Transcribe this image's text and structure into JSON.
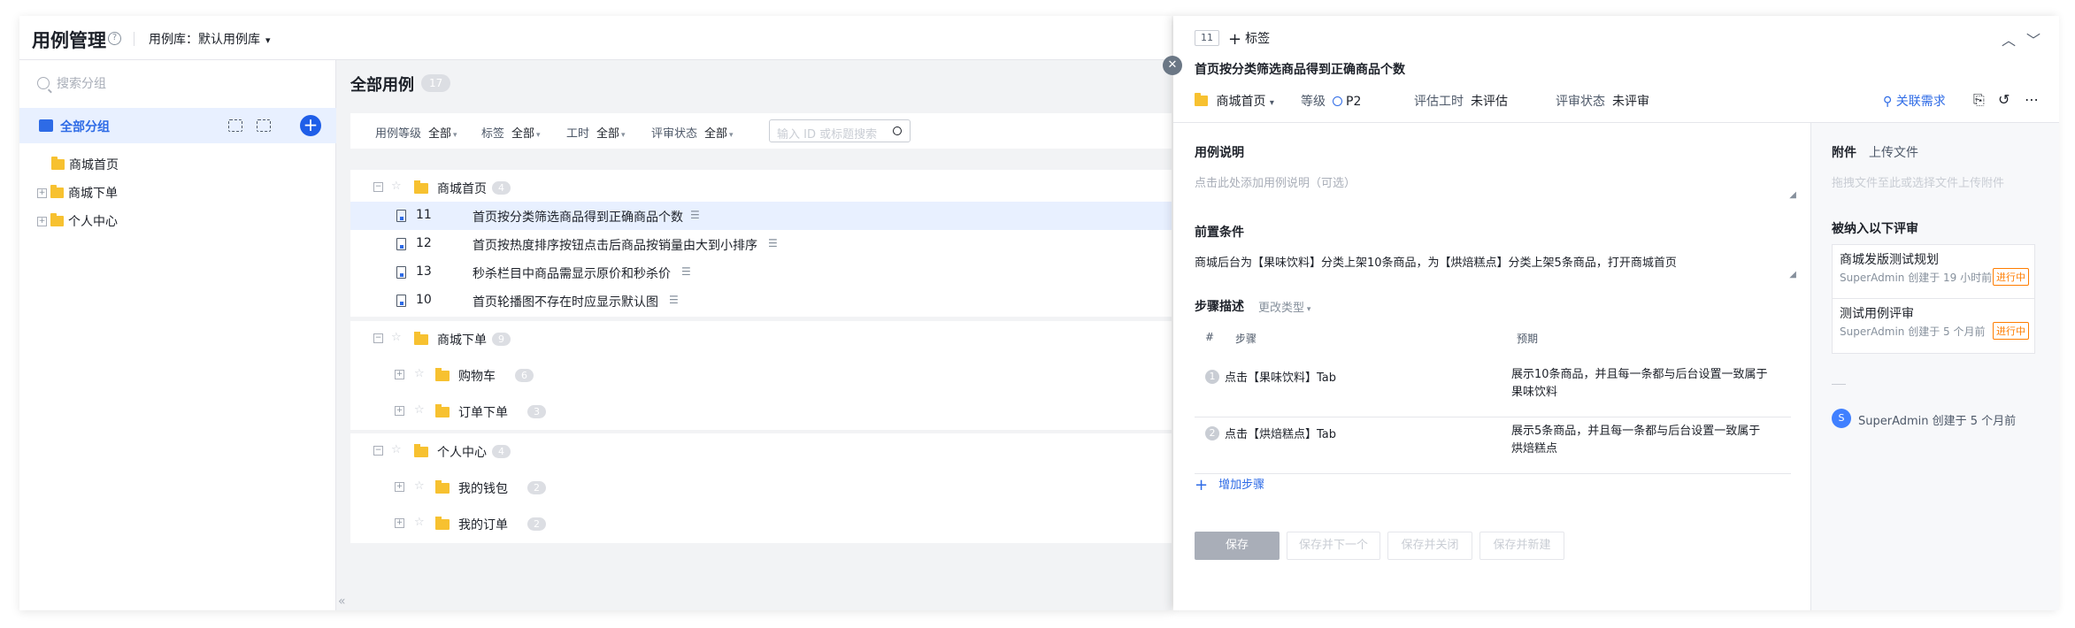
{
  "topbar": {
    "title": "用例管理",
    "help_glyph": "?",
    "library_label": "用例库：默认用例库"
  },
  "sidebar": {
    "search_placeholder": "搜索分组",
    "all_group": "全部分组",
    "tree": [
      {
        "label": "商城首页"
      },
      {
        "label": "商城下单"
      },
      {
        "label": "个人中心"
      }
    ]
  },
  "main": {
    "title": "全部用例",
    "count": "17",
    "filters": [
      {
        "label": "用例等级",
        "value": "全部"
      },
      {
        "label": "标签",
        "value": "全部"
      },
      {
        "label": "工时",
        "value": "全部"
      },
      {
        "label": "评审状态",
        "value": "全部"
      }
    ],
    "search_placeholder": "输入 ID 或标题搜索",
    "groups": [
      {
        "name": "商城首页",
        "count": "4",
        "cases": [
          {
            "id": "11",
            "title": "首页按分类筛选商品得到正确商品个数"
          },
          {
            "id": "12",
            "title": "首页按热度排序按钮点击后商品按销量由大到小排序"
          },
          {
            "id": "13",
            "title": "秒杀栏目中商品需显示原价和秒杀价"
          },
          {
            "id": "10",
            "title": "首页轮播图不存在时应显示默认图"
          }
        ]
      },
      {
        "name": "商城下单",
        "count": "9",
        "subgroups": [
          {
            "name": "购物车",
            "count": "6"
          },
          {
            "name": "订单下单",
            "count": "3"
          }
        ]
      },
      {
        "name": "个人中心",
        "count": "4",
        "subgroups": [
          {
            "name": "我的钱包",
            "count": "2"
          },
          {
            "name": "我的订单",
            "count": "2"
          }
        ]
      }
    ],
    "collapse_glyph": "«"
  },
  "detail": {
    "id": "11",
    "add_tag": "标签",
    "title": "首页按分类筛选商品得到正确商品个数",
    "folder": "商城首页",
    "level_label": "等级",
    "level_value": "P2",
    "hours_label": "评估工时",
    "hours_value": "未评估",
    "review_label": "评审状态",
    "review_value": "未评审",
    "link_requirement": "关联需求",
    "desc_label": "用例说明",
    "desc_placeholder": "点击此处添加用例说明（可选）",
    "precondition_label": "前置条件",
    "precondition_value": "商城后台为【果味饮料】分类上架10条商品，为【烘焙糕点】分类上架5条商品，打开商城首页",
    "steps_label": "步骤描述",
    "change_type": "更改类型",
    "steps_headers": {
      "no": "#",
      "step": "步骤",
      "expect": "预期"
    },
    "steps": [
      {
        "no": "1",
        "step": "点击【果味饮料】Tab",
        "expect": "展示10条商品，并且每一条都与后台设置一致属于果味饮料"
      },
      {
        "no": "2",
        "step": "点击【烘焙糕点】Tab",
        "expect": "展示5条商品，并且每一条都与后台设置一致属于烘焙糕点"
      }
    ],
    "add_step": "增加步骤",
    "buttons": {
      "save": "保存",
      "save_next": "保存并下一个",
      "save_close": "保存并关闭",
      "save_new": "保存并新建"
    },
    "attachments_label": "附件",
    "upload_label": "上传文件",
    "upload_hint": "拖拽文件至此或选择文件上传附件",
    "reviews_label": "被纳入以下评审",
    "reviews": [
      {
        "title": "商城发版测试规划",
        "sub": "SuperAdmin 创建于 19 小时前",
        "status": "进行中"
      },
      {
        "title": "测试用例评审",
        "sub": "SuperAdmin 创建于 5 个月前",
        "status": "进行中"
      }
    ],
    "history_avatar": "S",
    "history_text": "SuperAdmin 创建于 5 个月前"
  },
  "colors": {
    "accent": "#2e6be6",
    "folder": "#f7c130",
    "status": "#ff7d00"
  }
}
